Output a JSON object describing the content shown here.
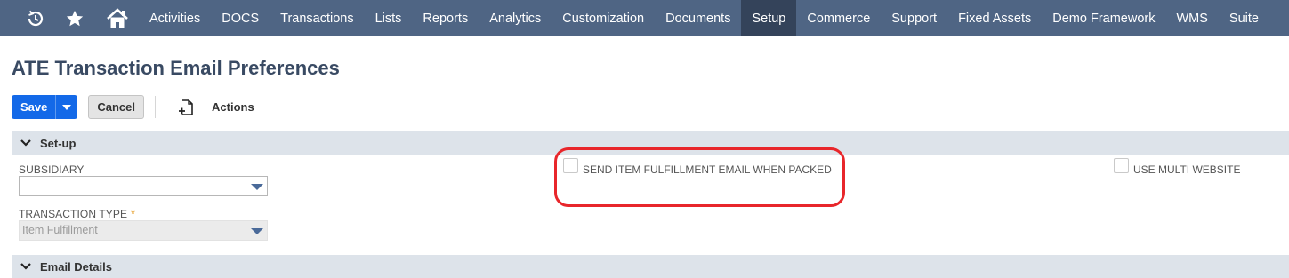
{
  "nav": {
    "icons": [
      "recent-history-icon",
      "star-icon",
      "home-icon"
    ],
    "items": [
      {
        "label": "Activities",
        "active": false
      },
      {
        "label": "DOCS",
        "active": false
      },
      {
        "label": "Transactions",
        "active": false
      },
      {
        "label": "Lists",
        "active": false
      },
      {
        "label": "Reports",
        "active": false
      },
      {
        "label": "Analytics",
        "active": false
      },
      {
        "label": "Customization",
        "active": false
      },
      {
        "label": "Documents",
        "active": false
      },
      {
        "label": "Setup",
        "active": true
      },
      {
        "label": "Commerce",
        "active": false
      },
      {
        "label": "Support",
        "active": false
      },
      {
        "label": "Fixed Assets",
        "active": false
      },
      {
        "label": "Demo Framework",
        "active": false
      },
      {
        "label": "WMS",
        "active": false
      },
      {
        "label": "Suite",
        "active": false
      }
    ]
  },
  "page": {
    "title": "ATE Transaction Email Preferences"
  },
  "toolbar": {
    "save_label": "Save",
    "cancel_label": "Cancel",
    "actions_label": "Actions"
  },
  "sections": {
    "setup": "Set-up",
    "email_details": "Email Details"
  },
  "fields": {
    "subsidiary": {
      "label": "SUBSIDIARY",
      "value": ""
    },
    "transaction_type": {
      "label": "TRANSACTION TYPE",
      "required_marker": "*",
      "value": "Item Fulfillment"
    },
    "send_fulfillment_email": {
      "label": "SEND ITEM FULFILLMENT EMAIL WHEN PACKED",
      "checked": false
    },
    "use_multi_website": {
      "label": "USE MULTI WEBSITE",
      "checked": false
    }
  },
  "colors": {
    "nav_bg": "#4f6584",
    "nav_active": "#34435a",
    "save_blue": "#1369e8",
    "highlight_red": "#e8262b"
  }
}
